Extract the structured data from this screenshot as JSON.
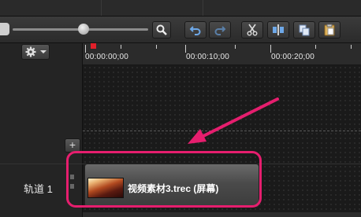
{
  "toolbar": {
    "buttons": [
      {
        "name": "zoom-search-icon"
      },
      {
        "name": "undo-icon"
      },
      {
        "name": "redo-icon"
      },
      {
        "name": "cut-icon"
      },
      {
        "name": "split-icon"
      },
      {
        "name": "copy-icon"
      },
      {
        "name": "paste-icon"
      }
    ],
    "zoom_level": 0.52
  },
  "ruler": {
    "times": [
      "00:00:00;00",
      "00:00:10;00",
      "00:00:20;00"
    ]
  },
  "tracks": [
    {
      "label": "轨道 1"
    }
  ],
  "clip": {
    "label": "视频素材3.trec (屏幕)"
  },
  "colors": {
    "highlight": "#e61e6e",
    "playhead": "#e0202a",
    "background": "#1f1f1f"
  }
}
